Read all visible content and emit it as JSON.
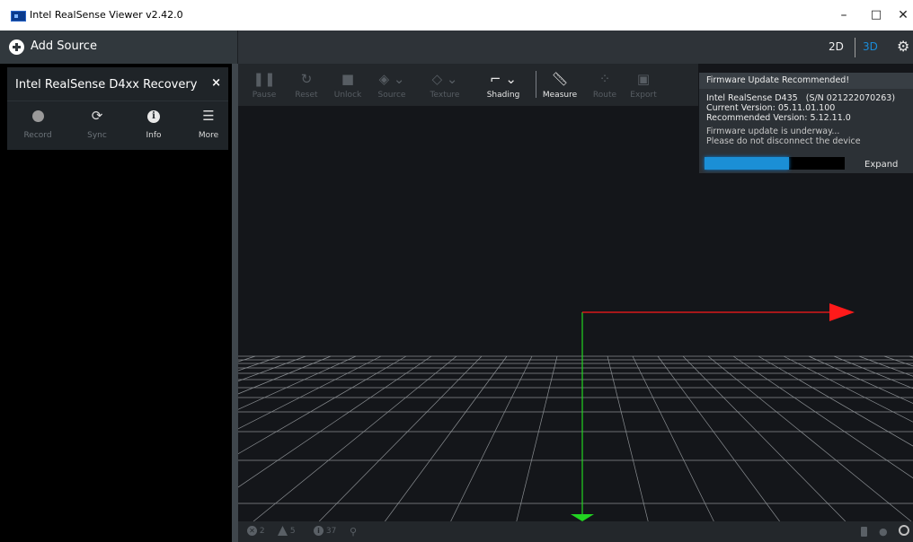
{
  "window": {
    "title": "Intel RealSense Viewer v2.42.0",
    "minimize_glyph": "–",
    "maximize_glyph": "□",
    "close_glyph": "✕"
  },
  "topbar": {
    "add_source_label": "Add Source",
    "view_2d": "2D",
    "view_3d": "3D",
    "active_view": "3D",
    "settings_icon": "gear-icon"
  },
  "device": {
    "name": "Intel RealSense D4xx Recovery",
    "close_glyph": "×",
    "actions": [
      {
        "label": "Record",
        "icon": "record-icon"
      },
      {
        "label": "Sync",
        "icon": "sync-icon"
      },
      {
        "label": "Info",
        "icon": "info-icon"
      },
      {
        "label": "More",
        "icon": "menu-icon"
      }
    ]
  },
  "toolbar": {
    "tools": [
      {
        "label": "Pause",
        "icon": "pause-icon",
        "enabled": false
      },
      {
        "label": "Reset",
        "icon": "reset-icon",
        "enabled": false
      },
      {
        "label": "Unlock",
        "icon": "lock-icon",
        "enabled": false
      },
      {
        "label": "Source",
        "icon": "cube-icon",
        "enabled": false
      },
      {
        "label": "Texture",
        "icon": "paint-bucket-icon",
        "enabled": false
      },
      {
        "label": "Shading",
        "icon": "paint-roller-icon",
        "enabled": true
      },
      {
        "label": "Measure",
        "icon": "ruler-icon",
        "enabled": true
      },
      {
        "label": "Route",
        "icon": "paw-icon",
        "enabled": false
      },
      {
        "label": "Export",
        "icon": "save-icon",
        "enabled": false
      }
    ]
  },
  "status_bar": {
    "errors_count": "2",
    "warnings_count": "5",
    "info_count": "37"
  },
  "firmware": {
    "title": "Firmware Update Recommended!",
    "device_line": "Intel RealSense D435   (S/N 021222070263)",
    "current_version": "Current Version: 05.11.01.100",
    "recommended_version": "Recommended Version: 5.12.11.0",
    "status_line1": "Firmware update is underway...",
    "status_line2": "Please do not disconnect the device",
    "progress_fraction": 0.6,
    "expand_label": "Expand"
  },
  "colors": {
    "accent": "#1b8fd6",
    "x_axis": "#ff1a1a",
    "y_axis": "#22d422",
    "grid": "#8a8e92"
  }
}
